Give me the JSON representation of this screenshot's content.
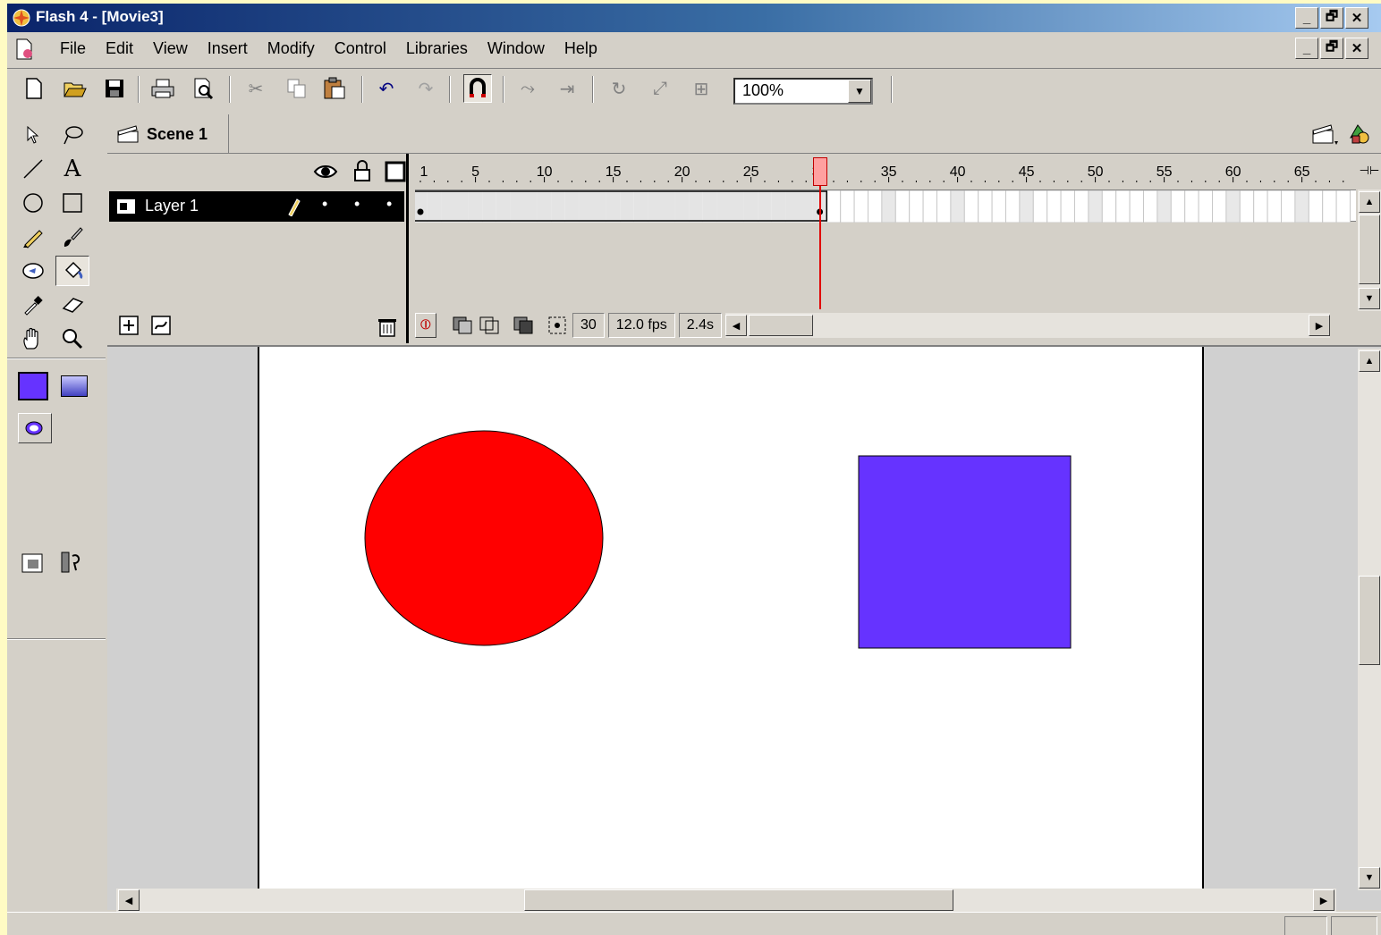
{
  "window": {
    "title": "Flash 4 - [Movie3]"
  },
  "title_buttons": {
    "minimize": "_",
    "restore": "🗗",
    "close": "✕"
  },
  "menu": [
    "File",
    "Edit",
    "View",
    "Insert",
    "Modify",
    "Control",
    "Libraries",
    "Window",
    "Help"
  ],
  "toolbar": {
    "zoom": "100%",
    "icons": [
      "new-icon",
      "open-icon",
      "save-icon",
      "print-icon",
      "print-preview-icon",
      "cut-icon",
      "copy-icon",
      "paste-icon",
      "undo-icon",
      "redo-icon",
      "snap-magnet-icon",
      "smooth-icon",
      "straighten-icon",
      "rotate-icon",
      "scale-icon",
      "align-icon"
    ]
  },
  "tools": [
    "arrow-icon",
    "lasso-icon",
    "line-icon",
    "text-icon",
    "oval-icon",
    "rectangle-icon",
    "pencil-icon",
    "brush-icon",
    "ink-bottle-icon",
    "paint-bucket-icon",
    "dropper-icon",
    "eraser-icon",
    "hand-icon",
    "magnifier-icon"
  ],
  "colors": {
    "fill": "#6633ff",
    "circle": "#ff0000",
    "square": "#6633ff",
    "accent": "#0a246a"
  },
  "scene": {
    "label": "Scene 1"
  },
  "timeline": {
    "layer_name": "Layer 1",
    "ruler_labels": [
      "1",
      "5",
      "10",
      "15",
      "20",
      "25",
      "30",
      "35",
      "40",
      "45",
      "50",
      "55",
      "60",
      "65"
    ],
    "current_frame": "30",
    "fps": "12.0 fps",
    "elapsed": "2.4s",
    "keyframes": [
      1,
      30
    ],
    "tween_frames": 30
  }
}
